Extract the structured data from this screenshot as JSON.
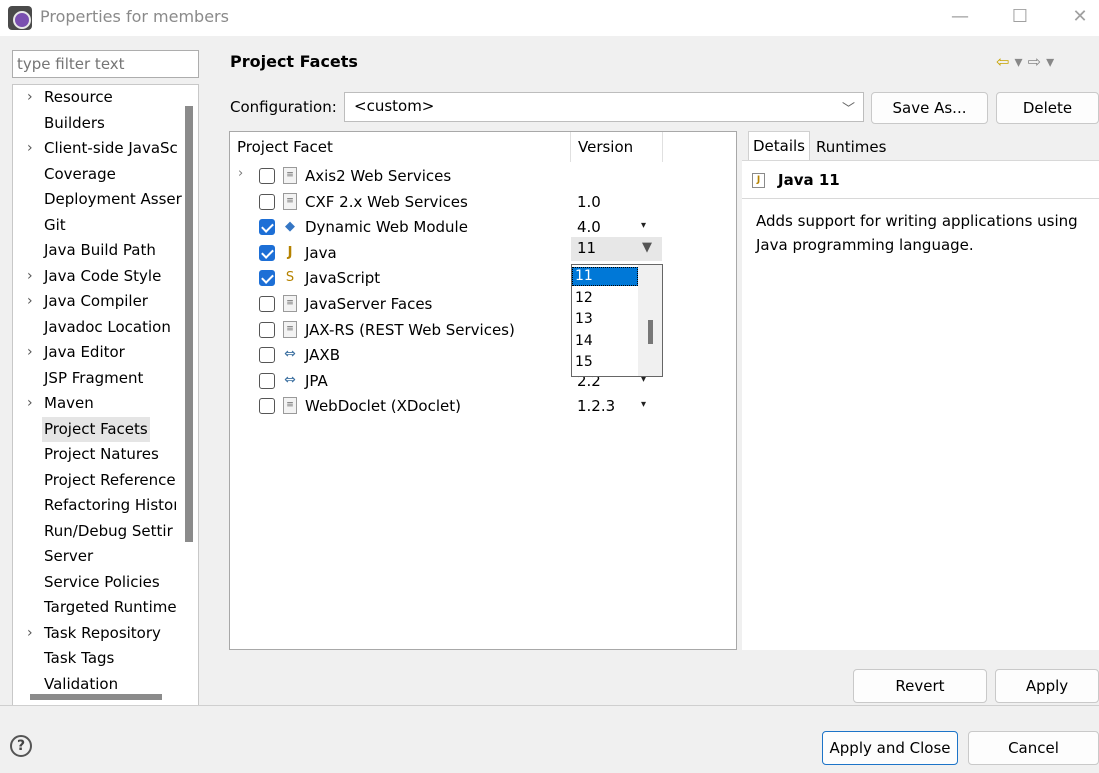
{
  "window": {
    "title": "Properties for members",
    "minimize_glyph": "—",
    "maximize_glyph": "☐",
    "close_glyph": "✕"
  },
  "filter": {
    "placeholder": "type filter text"
  },
  "nav": {
    "items": [
      {
        "label": "Resource",
        "expandable": true
      },
      {
        "label": "Builders",
        "expandable": false
      },
      {
        "label": "Client-side JavaSc",
        "expandable": true
      },
      {
        "label": "Coverage",
        "expandable": false
      },
      {
        "label": "Deployment Asser",
        "expandable": false
      },
      {
        "label": "Git",
        "expandable": false
      },
      {
        "label": "Java Build Path",
        "expandable": false
      },
      {
        "label": "Java Code Style",
        "expandable": true
      },
      {
        "label": "Java Compiler",
        "expandable": true
      },
      {
        "label": "Javadoc Location",
        "expandable": false
      },
      {
        "label": "Java Editor",
        "expandable": true
      },
      {
        "label": "JSP Fragment",
        "expandable": false
      },
      {
        "label": "Maven",
        "expandable": true
      },
      {
        "label": "Project Facets",
        "expandable": false,
        "selected": true
      },
      {
        "label": "Project Natures",
        "expandable": false
      },
      {
        "label": "Project Reference",
        "expandable": false
      },
      {
        "label": "Refactoring Histoı",
        "expandable": false
      },
      {
        "label": "Run/Debug Settir",
        "expandable": false
      },
      {
        "label": "Server",
        "expandable": false
      },
      {
        "label": "Service Policies",
        "expandable": false
      },
      {
        "label": "Targeted Runtime",
        "expandable": false
      },
      {
        "label": "Task Repository",
        "expandable": true
      },
      {
        "label": "Task Tags",
        "expandable": false
      },
      {
        "label": "Validation",
        "expandable": false
      }
    ]
  },
  "page": {
    "title": "Project Facets",
    "back_glyph": "⇦",
    "forward_glyph": "⇨",
    "menu_glyph": "▾"
  },
  "config": {
    "label": "Configuration:",
    "value": "<custom>",
    "save_as": "Save As...",
    "delete": "Delete"
  },
  "facets": {
    "col_facet": "Project Facet",
    "col_version": "Version",
    "rows": [
      {
        "name": "Axis2 Web Services",
        "version": "",
        "checked": false,
        "expandable": true,
        "icon": "doc",
        "has_arrow": false
      },
      {
        "name": "CXF 2.x Web Services",
        "version": "1.0",
        "checked": false,
        "expandable": false,
        "icon": "doc",
        "has_arrow": false
      },
      {
        "name": "Dynamic Web Module",
        "version": "4.0",
        "checked": true,
        "expandable": false,
        "icon": "web",
        "has_arrow": true
      },
      {
        "name": "Java",
        "version": "11",
        "checked": true,
        "expandable": false,
        "icon": "java",
        "has_arrow": false
      },
      {
        "name": "JavaScript",
        "version": "",
        "checked": true,
        "expandable": false,
        "icon": "js",
        "has_arrow": false
      },
      {
        "name": "JavaServer Faces",
        "version": "",
        "checked": false,
        "expandable": false,
        "icon": "doc",
        "has_arrow": false
      },
      {
        "name": "JAX-RS (REST Web Services)",
        "version": "",
        "checked": false,
        "expandable": false,
        "icon": "doc",
        "has_arrow": false
      },
      {
        "name": "JAXB",
        "version": "",
        "checked": false,
        "expandable": false,
        "icon": "link",
        "has_arrow": false
      },
      {
        "name": "JPA",
        "version": "2.2",
        "checked": false,
        "expandable": false,
        "icon": "link",
        "has_arrow": true
      },
      {
        "name": "WebDoclet (XDoclet)",
        "version": "1.2.3",
        "checked": false,
        "expandable": false,
        "icon": "doc",
        "has_arrow": true
      }
    ]
  },
  "version_dropdown": {
    "current": "11",
    "options": [
      "11",
      "12",
      "13",
      "14",
      "15"
    ],
    "selected_index": 0
  },
  "details": {
    "tab_details": "Details",
    "tab_runtimes": "Runtimes",
    "title": "Java 11",
    "icon_glyph": "J",
    "description": "Adds support for writing applications using Java programming language."
  },
  "buttons": {
    "revert": "Revert",
    "apply": "Apply",
    "apply_close": "Apply and Close",
    "cancel": "Cancel"
  },
  "help": {
    "glyph": "?"
  }
}
